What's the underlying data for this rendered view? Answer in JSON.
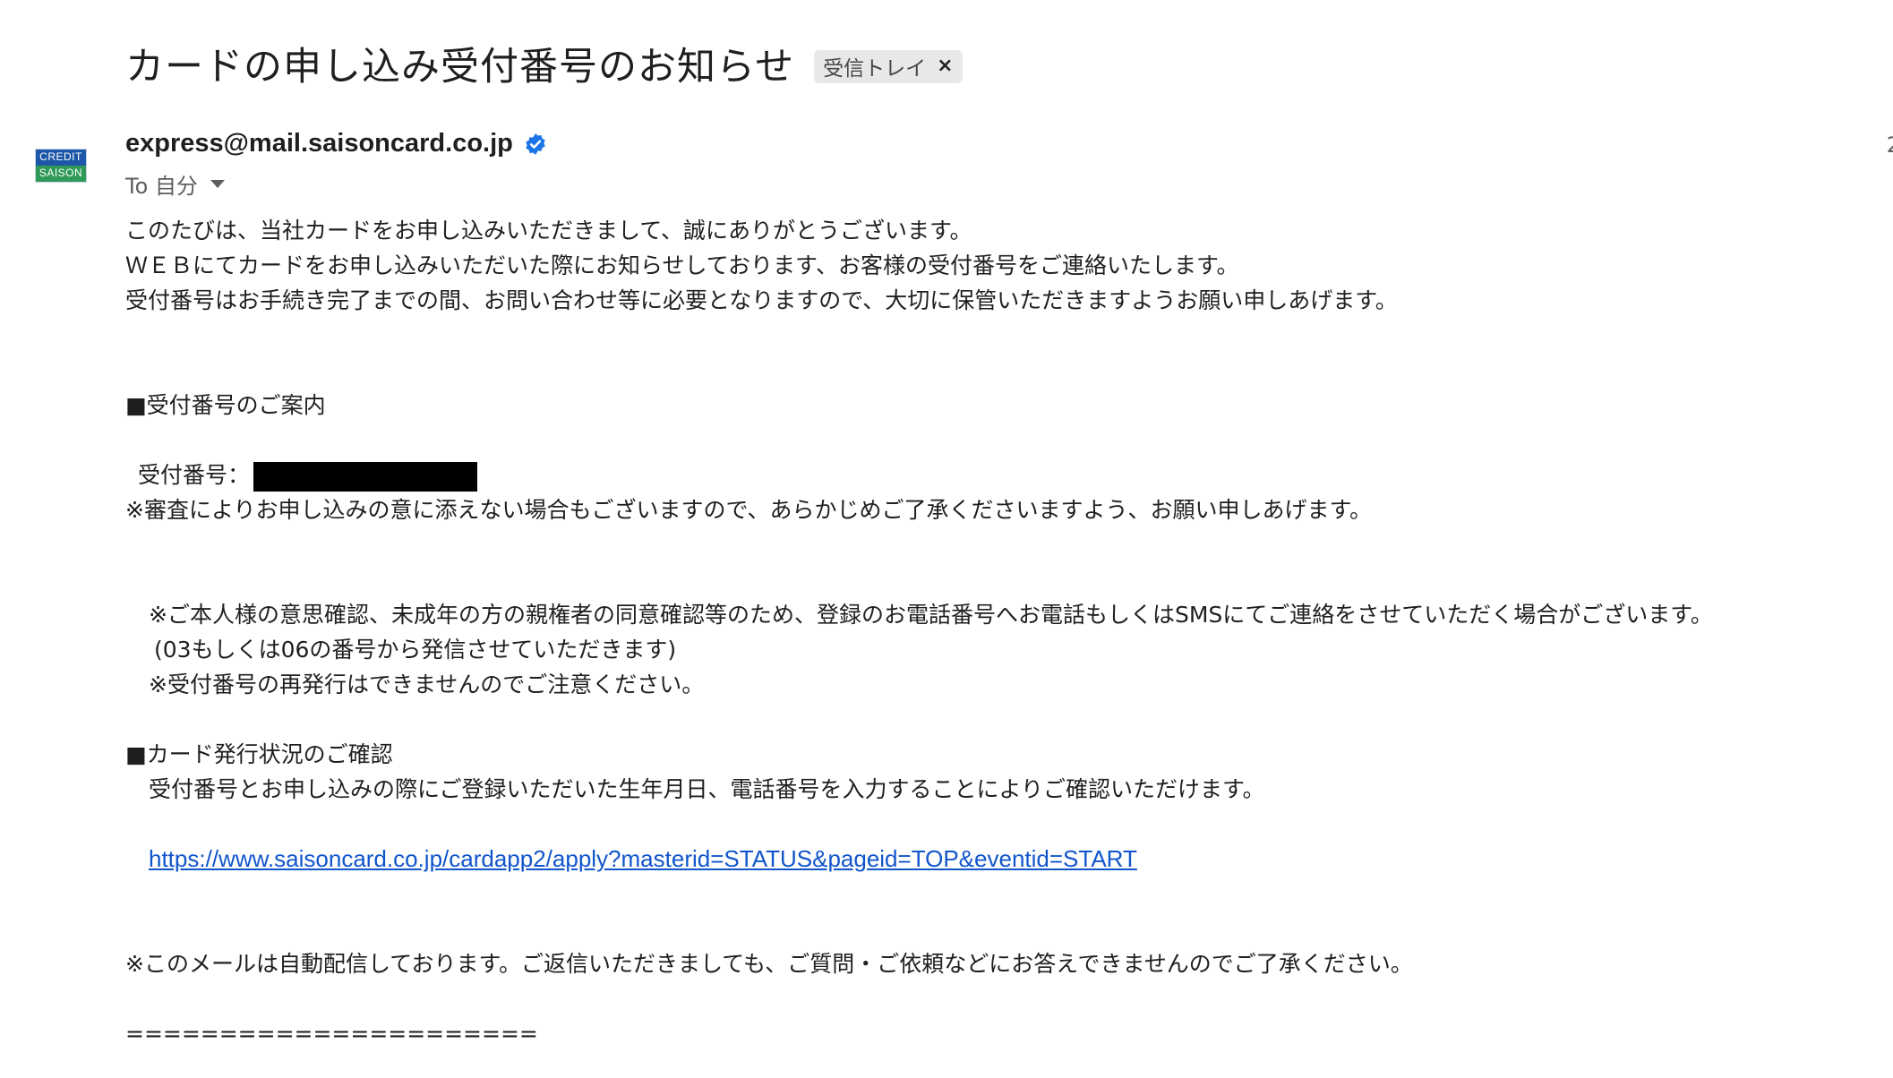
{
  "email": {
    "subject": "カードの申し込み受付番号のお知らせ",
    "label_chip": "受信トレイ",
    "label_chip_close": "×",
    "avatar_text_top": "CREDIT",
    "avatar_text_bottom": "SAISON",
    "sender_email": "express@mail.saisoncard.co.jp",
    "recipient_text": "To 自分",
    "timestamp_partial": "2"
  },
  "body": {
    "p1": "このたびは、当社カードをお申し込みいただきまして、誠にありがとうございます。",
    "p2": "ＷＥＢにてカードをお申し込みいただいた際にお知らせしております、お客様の受付番号をご連絡いたします。",
    "p3": "受付番号はお手続き完了までの間、お問い合わせ等に必要となりますので、大切に保管いただきますようお願い申しあげます。",
    "section1_heading": "■受付番号のご案内",
    "receipt_label": "受付番号：",
    "note1": "※審査によりお申し込みの意に添えない場合もございますので、あらかじめご了承くださいますよう、お願い申しあげます。",
    "note2": "※ご本人様の意思確認、未成年の方の親権者の同意確認等のため、登録のお電話番号へお電話もしくはSMSにてご連絡をさせていただく場合がございます。",
    "note2_sub": "(03もしくは06の番号から発信させていただきます)",
    "note3": "※受付番号の再発行はできませんのでご注意ください。",
    "section2_heading": "■カード発行状況のご確認",
    "section2_text": "受付番号とお申し込みの際にご登録いただいた生年月日、電話番号を入力することによりご確認いただけます。",
    "status_link": "https://www.saisoncard.co.jp/cardapp2/apply?masterid=STATUS&pageid=TOP&eventid=START",
    "auto_notice": "※このメールは自動配信しております。ご返信いただきましても、ご質問・ご依頼などにお答えできませんのでご了承ください。",
    "separator": "======================"
  },
  "colors": {
    "link": "#1155cc",
    "verified_badge": "#1a73e8",
    "chip_bg": "#e8e8e8"
  },
  "icons": {
    "verified": "verified-badge-icon",
    "caret": "chevron-down-icon",
    "chip_close": "close-icon"
  }
}
